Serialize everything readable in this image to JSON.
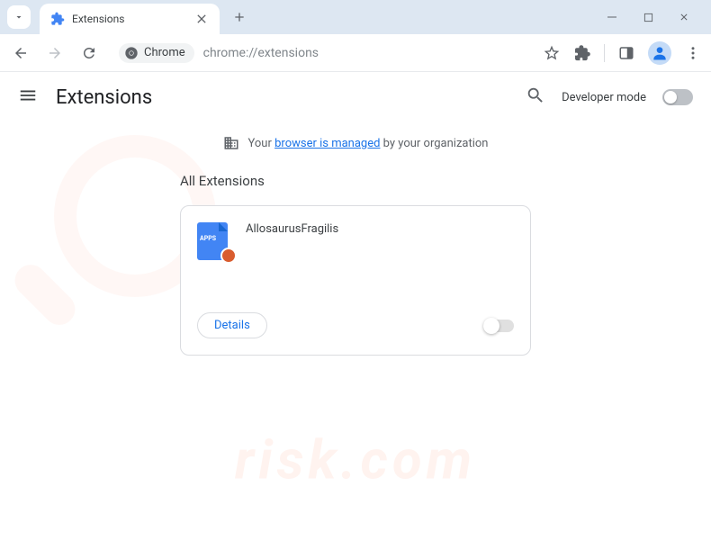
{
  "tab": {
    "title": "Extensions"
  },
  "address": {
    "chip_label": "Chrome",
    "url": "chrome://extensions"
  },
  "header": {
    "title": "Extensions",
    "dev_mode_label": "Developer mode"
  },
  "managed_banner": {
    "prefix": "Your ",
    "link": "browser is managed",
    "suffix": " by your organization"
  },
  "section": {
    "title": "All Extensions"
  },
  "extension": {
    "name": "AllosaurusFragilis",
    "icon_text": "APPS",
    "details_label": "Details"
  }
}
